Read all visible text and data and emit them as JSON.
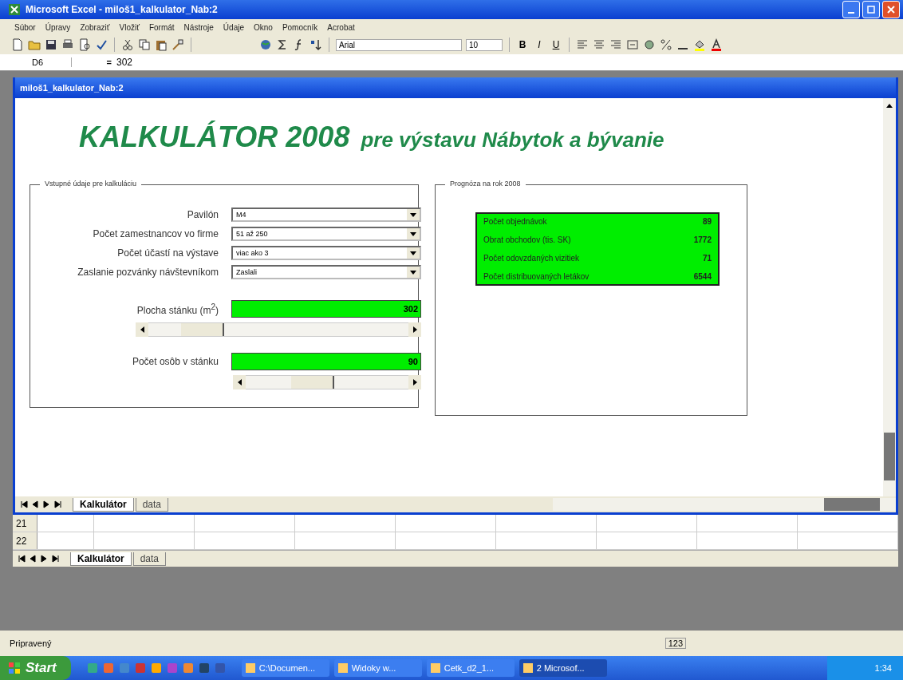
{
  "window": {
    "title": "Microsoft Excel - miloš1_kalkulator_Nab:2"
  },
  "menu": [
    "Súbor",
    "Úpravy",
    "Zobraziť",
    "Vložiť",
    "Formát",
    "Nástroje",
    "Údaje",
    "Okno",
    "Pomocník",
    "Acrobat"
  ],
  "toolbar": {
    "font": "Arial",
    "size": "10",
    "format_buttons": [
      "B",
      "I",
      "U"
    ]
  },
  "formula_bar": {
    "cell": "D6",
    "equals": "=",
    "value": "302"
  },
  "workbook": {
    "title": "miloš1_kalkulator_Nab:2"
  },
  "heading": {
    "main": "KALKULÁTOR 2008",
    "sub": "pre výstavu Nábytok a bývanie"
  },
  "inputs": {
    "legend": "Vstupné údaje pre kalkuláciu",
    "dropdowns": [
      {
        "label": "Pavilón",
        "value": "M4"
      },
      {
        "label": "Počet zamestnancov vo firme",
        "value": "51 až 250"
      },
      {
        "label": "Počet účastí na výstave",
        "value": "viac ako 3"
      },
      {
        "label": "Zaslanie pozvánky návštevníkom",
        "value": "Zaslali"
      }
    ],
    "sliders": [
      {
        "label": "Plocha stánku (m$^{2}$)",
        "value": "302",
        "level": 0.15
      },
      {
        "label": "Počet osôb v stánku",
        "value": "90",
        "level": 0.38
      }
    ]
  },
  "forecast": {
    "legend": "Prognóza na rok 2008",
    "rows": [
      {
        "label": "Počet objednávok",
        "value": "89"
      },
      {
        "label": "Obrat obchodov (tis. SK)",
        "value": "1772"
      },
      {
        "label": "Počet odovzdaných vizitiek",
        "value": "71"
      },
      {
        "label": "Počet distribuovaných letákov",
        "value": "6544"
      }
    ]
  },
  "sheet_tabs": [
    {
      "label": "Kalkulátor",
      "selected": true
    },
    {
      "label": "data",
      "selected": false
    }
  ],
  "grid_rows": [
    "21",
    "22"
  ],
  "lower_sheet_tabs": [
    {
      "label": "Kalkulátor",
      "selected": true
    },
    {
      "label": "data",
      "selected": false
    }
  ],
  "status_bar": {
    "text": "Pripravený",
    "indicator": "123"
  },
  "taskbar": {
    "start": "Start",
    "tasks": [
      {
        "label": "C:\\Documen...",
        "selected": false
      },
      {
        "label": "Widoky w...",
        "selected": false
      },
      {
        "label": "Cetk_d2_1...",
        "selected": false
      },
      {
        "label": "2 Microsof...",
        "selected": true
      }
    ],
    "clock": "1:34"
  }
}
